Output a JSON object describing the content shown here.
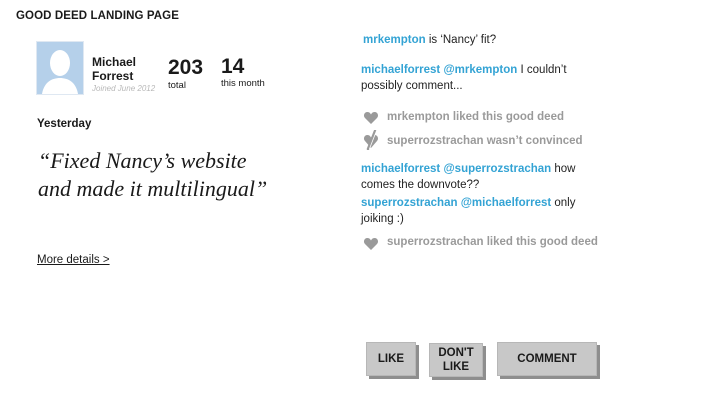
{
  "page": {
    "title": "GOOD DEED LANDING PAGE"
  },
  "profile": {
    "name": "Michael Forrest",
    "joined": "Joined June 2012",
    "total_value": "203",
    "total_label": "total",
    "month_value": "14",
    "month_label": "this month"
  },
  "deed": {
    "day": "Yesterday",
    "quote": "“Fixed Nancy’s website and made it multilingual”",
    "more_link": "More details >"
  },
  "feed": {
    "c1": {
      "user": "mrkempton",
      "text": " is ‘Nancy’ fit?"
    },
    "c2": {
      "user": "michaelforrest",
      "mention": "@mrkempton",
      "text": "  I couldn’t possibly comment..."
    },
    "a1": "mrkempton liked this good deed",
    "a2": "superrozstrachan wasn’t convinced",
    "c3": {
      "user": "michaelforrest",
      "mention": "@superrozstrachan",
      "text": "  how comes the downvote??"
    },
    "c4": {
      "user": "superrozstrachan",
      "mention": "@michaelforrest",
      "text": " only joiking :)"
    },
    "a3": "superrozstrachan liked this good deed"
  },
  "actions": {
    "like": "LIKE",
    "dont_like": "DON'T LIKE",
    "comment": "COMMENT"
  },
  "colors": {
    "accent": "#33a3d4",
    "muted": "#9a9a9a",
    "button": "#c8c8c8"
  },
  "icons": {
    "like": "heart-icon",
    "dislike": "broken-heart-icon"
  }
}
